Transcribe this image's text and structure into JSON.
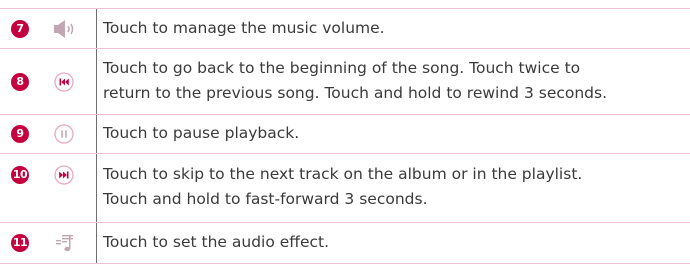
{
  "rows": [
    {
      "number": "7",
      "icon": "volume-icon",
      "lines": [
        "Touch to manage the music volume."
      ]
    },
    {
      "number": "8",
      "icon": "previous-icon",
      "lines": [
        "Touch to go back to the beginning of the song. Touch twice to",
        "return to the previous song. Touch and hold to rewind 3 seconds."
      ]
    },
    {
      "number": "9",
      "icon": "pause-icon",
      "lines": [
        "Touch to pause playback."
      ]
    },
    {
      "number": "10",
      "icon": "next-icon",
      "lines": [
        "Touch to skip to the next track on the album or in the playlist.",
        "Touch and hold to fast-forward 3 seconds."
      ]
    },
    {
      "number": "11",
      "icon": "audio-effect-icon",
      "lines": [
        "Touch to set the audio effect."
      ]
    }
  ],
  "colors": {
    "accent": "#c5003e",
    "rule": "#efbfd5",
    "icon_ring": "#e6a9c1",
    "icon_glyph": "#c2a6b2",
    "text": "#3a3a3a"
  }
}
